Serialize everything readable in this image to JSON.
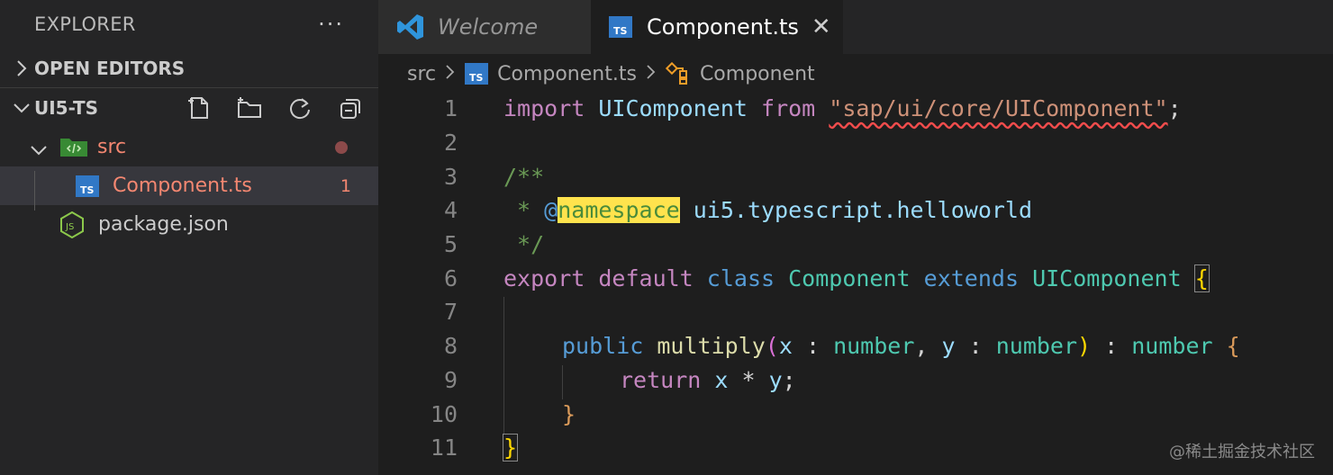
{
  "sidebar": {
    "title": "EXPLORER",
    "more": "···",
    "open_editors_label": "OPEN EDITORS",
    "workspace_label": "UI5-TS",
    "tree": {
      "src_label": "src",
      "component_label": "Component.ts",
      "component_badge": "1",
      "package_label": "package.json"
    }
  },
  "tabs": {
    "welcome": "Welcome",
    "component": "Component.ts",
    "close": "✕"
  },
  "breadcrumb": {
    "folder": "src",
    "file": "Component.ts",
    "symbol": "Component"
  },
  "editor": {
    "line_numbers": [
      "1",
      "2",
      "3",
      "4",
      "5",
      "6",
      "7",
      "8",
      "9",
      "10",
      "11"
    ],
    "line1": {
      "import": "import",
      "ident": "UIComponent",
      "from": "from",
      "module": "\"sap/ui/core/UIComponent\"",
      "semi": ";"
    },
    "line3": "/**",
    "line4": {
      "star": " * ",
      "tag": "@namespace",
      "rest": " ui5.typescript.helloworld"
    },
    "line5": " */",
    "line6": {
      "export": "export",
      "default": "default",
      "class": "class",
      "name": "Component",
      "extends": "extends",
      "base": "UIComponent",
      "brace": "{"
    },
    "line8": {
      "public": "public",
      "method": "multiply",
      "open": "(",
      "x": "x",
      "colon1": " : ",
      "t1": "number",
      "comma": ", ",
      "y": "y",
      "colon2": " : ",
      "t2": "number",
      "close": ")",
      "colon3": " : ",
      "t3": "number",
      "brace": " {"
    },
    "line9": {
      "return": "return",
      "x": "x",
      "op": " * ",
      "y": "y",
      "semi": ";"
    },
    "line10": "}",
    "line11": "}"
  },
  "watermark": "@稀土掘金技术社区",
  "colors": {
    "ts_badge": "#3178c6",
    "folder": "#388a34",
    "node": "#8cc84b"
  }
}
